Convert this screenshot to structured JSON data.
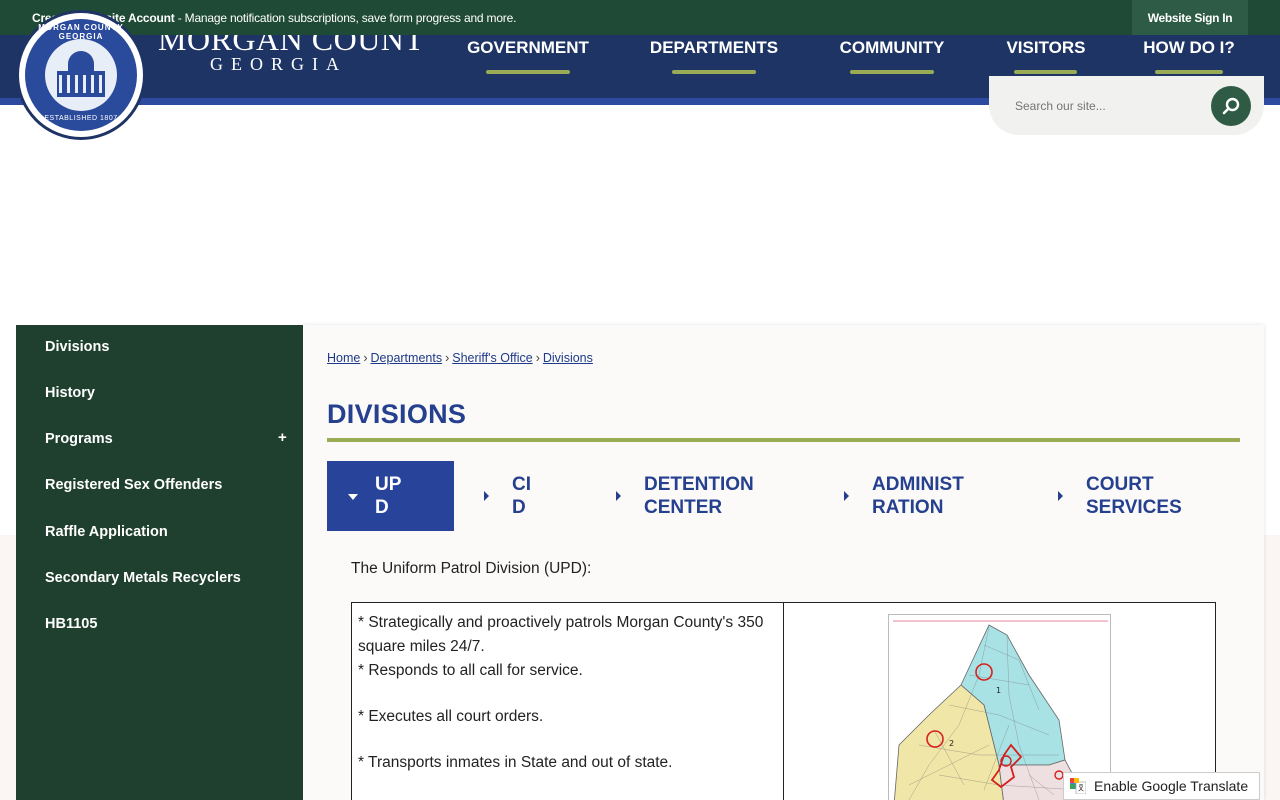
{
  "topbar": {
    "account_bold": "Create a Website Account",
    "account_text": " - Manage notification subscriptions, save form progress and more.",
    "signin_label": "Website Sign In"
  },
  "brand": {
    "name": "MORGAN COUNTY",
    "sub": "GEORGIA",
    "seal_top": "MORGAN COUNTY GEORGIA",
    "seal_bottom": "ESTABLISHED 1807"
  },
  "nav": {
    "items": [
      {
        "label": "GOVERNMENT"
      },
      {
        "label": "DEPARTMENTS"
      },
      {
        "label": "COMMUNITY"
      },
      {
        "label": "VISITORS"
      },
      {
        "label": "HOW DO I?"
      }
    ]
  },
  "search": {
    "placeholder": "Search our site..."
  },
  "sidebar": {
    "items": [
      {
        "label": "Divisions"
      },
      {
        "label": "History"
      },
      {
        "label": "Programs",
        "expand": "+"
      },
      {
        "label": "Registered Sex Offenders"
      },
      {
        "label": "Raffle Application"
      },
      {
        "label": "Secondary Metals Recyclers"
      },
      {
        "label": "HB1105"
      }
    ]
  },
  "breadcrumb": {
    "items": [
      "Home",
      "Departments",
      "Sheriff's Office",
      "Divisions"
    ],
    "separator": "›"
  },
  "page": {
    "title": "DIVISIONS",
    "tabs": [
      {
        "label": "UP\nD",
        "active": true
      },
      {
        "label": "CI\nD"
      },
      {
        "label": "DETENTION\nCENTER"
      },
      {
        "label": "ADMINIST\nRATION"
      },
      {
        "label": "COURT\nSERVICES"
      }
    ],
    "intro": "The Uniform Patrol Division (UPD):",
    "duties": [
      "* Strategically and proactively patrols Morgan County's 350 square miles 24/7.",
      "* Responds to all call for service.",
      "* Executes all court orders.",
      "* Transports inmates in State and out of state."
    ],
    "map_zones": [
      "1",
      "2"
    ]
  },
  "translate": {
    "label": "Enable Google Translate"
  },
  "colors": {
    "topbar": "#1f4a36",
    "header": "#1e3465",
    "accent_green": "#9aab55",
    "title_blue": "#24408f",
    "sidebar": "#20402f"
  }
}
